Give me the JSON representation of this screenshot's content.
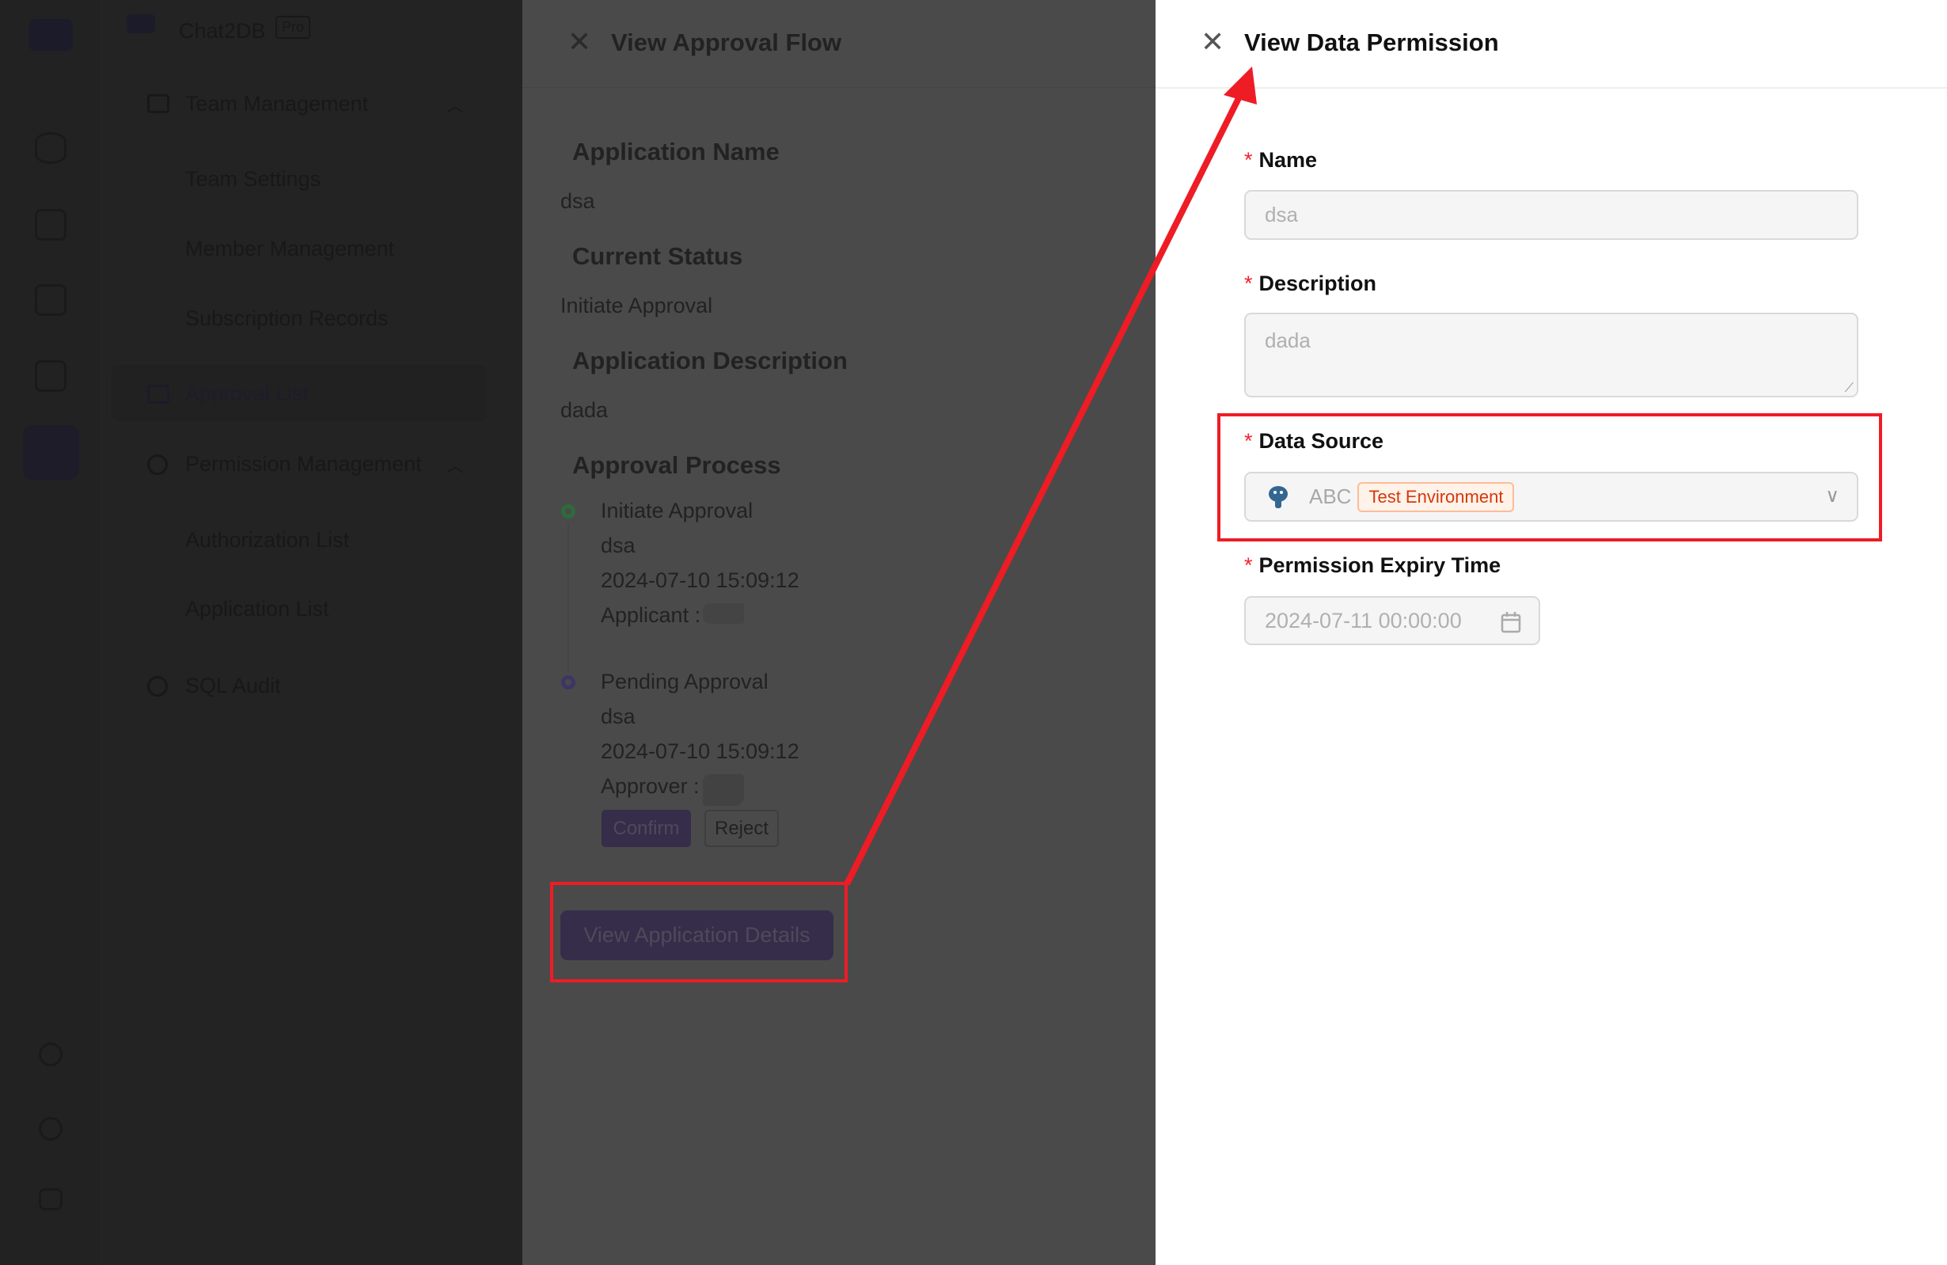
{
  "sidebar": {
    "brand": "Chat2DB",
    "brand_badge": "Pro",
    "rail_icons": [
      "logo-icon",
      "database-icon",
      "chart-icon",
      "chat-icon",
      "apps-icon",
      "team-icon",
      "help-icon",
      "settings-icon",
      "message-icon"
    ],
    "items": [
      {
        "label": "Team Management",
        "icon": "mail-icon"
      },
      {
        "label": "Team Settings"
      },
      {
        "label": "Member Management"
      },
      {
        "label": "Subscription Records"
      },
      {
        "label": "Approval List",
        "icon": "grid-icon"
      },
      {
        "label": "Permission Management",
        "icon": "gear-icon"
      },
      {
        "label": "Authorization List"
      },
      {
        "label": "Application List"
      },
      {
        "label": "SQL Audit",
        "icon": "gear-icon"
      }
    ]
  },
  "approval_flow": {
    "title": "View Approval Flow",
    "application_name_label": "Application Name",
    "application_name": "dsa",
    "current_status_label": "Current Status",
    "current_status": "Initiate Approval",
    "description_label": "Application Description",
    "description": "dada",
    "process_label": "Approval Process",
    "steps": [
      {
        "title": "Initiate Approval",
        "name": "dsa",
        "time": "2024-07-10 15:09:12",
        "person_label": "Applicant :",
        "color": "#2e6b3a"
      },
      {
        "title": "Pending Approval",
        "name": "dsa",
        "time": "2024-07-10 15:09:12",
        "person_label": "Approver :",
        "color": "#3d3566"
      }
    ],
    "confirm_label": "Confirm",
    "reject_label": "Reject",
    "view_details_label": "View Application Details"
  },
  "data_permission": {
    "title": "View Data Permission",
    "name_label": "Name",
    "name_value": "dsa",
    "description_label": "Description",
    "description_value": "dada",
    "data_source_label": "Data Source",
    "data_source_value": "ABC",
    "data_source_tag": "Test Environment",
    "data_source_icon": "postgresql-icon",
    "expiry_label": "Permission Expiry Time",
    "expiry_value": "2024-07-11 00:00:00",
    "required_mark": "*"
  },
  "colors": {
    "annotation": "#ee1c25",
    "tag_text": "#d4380d",
    "tag_bg": "#fff2e8",
    "tag_border": "#ffbb96"
  }
}
